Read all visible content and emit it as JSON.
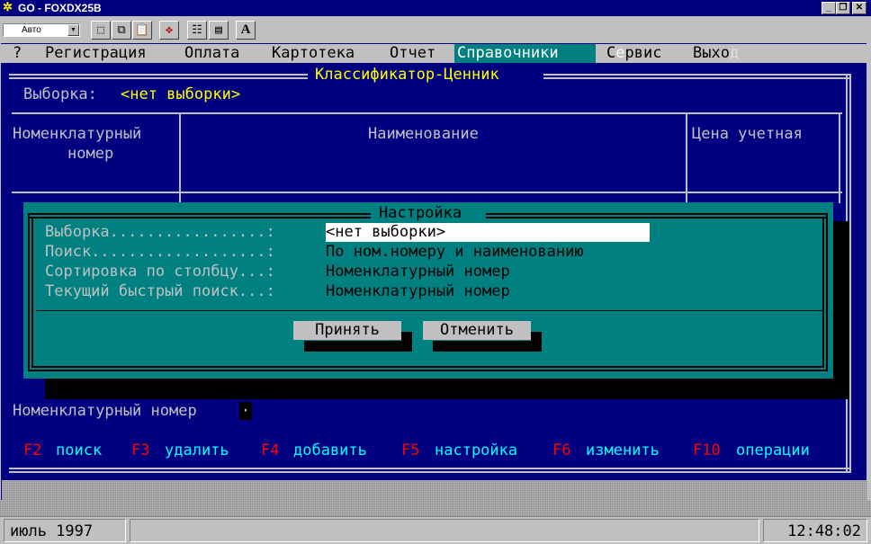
{
  "window": {
    "title": "GO - FOXDX25B",
    "controls": [
      "_",
      "❐",
      "✕"
    ]
  },
  "toolbar": {
    "font_select": "Авто",
    "dropdown_glyph": "▼",
    "letter_button": "A"
  },
  "menu": {
    "items": [
      {
        "label": "?"
      },
      {
        "label": "Регистрация"
      },
      {
        "label": "Оплата"
      },
      {
        "label": "Картотека"
      },
      {
        "label": "Отчет"
      },
      {
        "label": "Справочники"
      },
      {
        "label_a": "С",
        "label_b": "е",
        "label_c": "рвис"
      },
      {
        "label_a": "Выхо",
        "label_b": "д"
      }
    ]
  },
  "main": {
    "title": "Классификатор-Ценник",
    "selection_label": "Выборка:",
    "selection_value": "<нет выборки>",
    "columns": [
      {
        "line1": "Номенклатурный",
        "line2": "номер"
      },
      {
        "line1": "Наименование",
        "line2": ""
      },
      {
        "line1": "Цена учетная",
        "line2": ""
      }
    ],
    "search_field_label": "Номенклатурный номер",
    "search_cursor": "·"
  },
  "dialog": {
    "title": "Настройка",
    "rows": [
      {
        "label": "Выборка.................:",
        "value": "<нет выборки>"
      },
      {
        "label": "Поиск...................:",
        "value": "По ном.номеру и наименованию"
      },
      {
        "label": "Сортировка по столбцу...:",
        "value": "Номенклатурный номер"
      },
      {
        "label": "Текущий быстрый поиск...:",
        "value": "Номенклатурный номер"
      }
    ],
    "accept_label": "Принять",
    "cancel_label": "Отменить"
  },
  "function_keys": [
    {
      "key": "F2",
      "label": "поиск"
    },
    {
      "key": "F3",
      "label": "удалить"
    },
    {
      "key": "F4",
      "label": "добавить"
    },
    {
      "key": "F5",
      "label": "настройка"
    },
    {
      "key": "F6",
      "label": "изменить"
    },
    {
      "key": "F10",
      "label": "операции"
    }
  ],
  "status": {
    "date": "июль 1997",
    "time": "12:48:02"
  },
  "colors": {
    "console_bg": "#000080",
    "dialog_bg": "#008080",
    "menu_bg": "#c0c0c0",
    "highlight_yellow": "#ffff00",
    "fkey_red": "#ff0000",
    "text_gray": "#c0c0c0"
  }
}
